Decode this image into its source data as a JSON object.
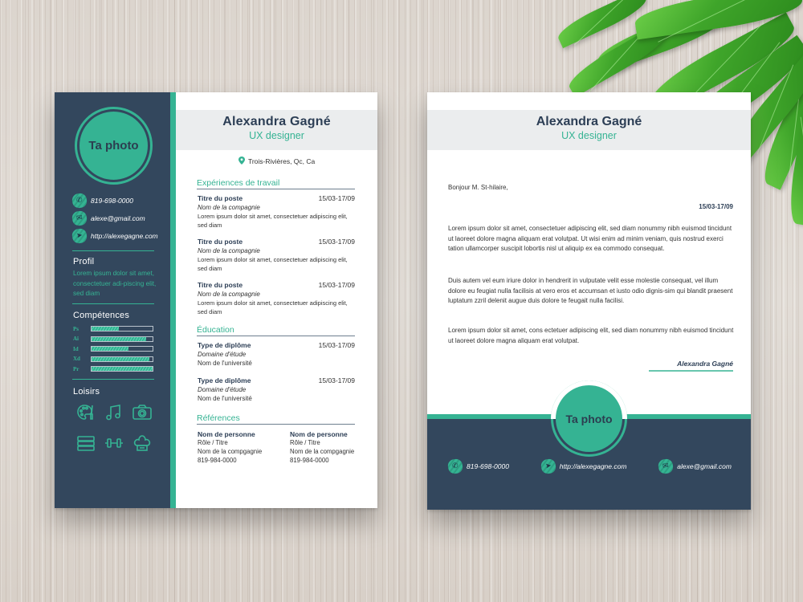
{
  "cv": {
    "photo_label": "Ta photo",
    "name": "Alexandra Gagné",
    "role": "UX designer",
    "location": "Trois-Rivières, Qc, Ca",
    "contacts": [
      {
        "icon": "phone-icon",
        "glyph": "✆",
        "text": "819-698-0000"
      },
      {
        "icon": "mail-icon",
        "glyph": "✉",
        "text": "alexe@gmail.com"
      },
      {
        "icon": "cursor-icon",
        "glyph": "➤",
        "text": "http://alexegagne.com"
      }
    ],
    "profile": {
      "title": "Profil",
      "text": "Lorem ipsum dolor sit amet, consectetuer adi-piscing elit, sed diam"
    },
    "skills": {
      "title": "Compétences",
      "items": [
        {
          "label": "Ps",
          "level": 0.45
        },
        {
          "label": "Ai",
          "level": 0.9
        },
        {
          "label": "Id",
          "level": 0.6
        },
        {
          "label": "Xd",
          "level": 0.95
        },
        {
          "label": "Pr",
          "level": 1.0
        }
      ]
    },
    "hobbies": {
      "title": "Loisirs",
      "icons": [
        "palette-icon",
        "music-note-icon",
        "camera-icon",
        "books-icon",
        "dumbbell-icon",
        "chef-hat-icon"
      ]
    },
    "experience": {
      "title": "Expériences de travail",
      "items": [
        {
          "title": "Titre du poste",
          "date": "15/03-17/09",
          "company": "Nom de la compagnie",
          "desc": "Lorem ipsum dolor sit amet, consectetuer adipiscing elit, sed diam"
        },
        {
          "title": "Titre du poste",
          "date": "15/03-17/09",
          "company": "Nom de la compagnie",
          "desc": "Lorem ipsum dolor sit amet, consectetuer adipiscing elit, sed diam"
        },
        {
          "title": "Titre du poste",
          "date": "15/03-17/09",
          "company": "Nom de la compagnie",
          "desc": "Lorem ipsum dolor sit amet, consectetuer adipiscing elit, sed diam"
        }
      ]
    },
    "education": {
      "title": "Éducation",
      "items": [
        {
          "title": "Type de diplôme",
          "date": "15/03-17/09",
          "field": "Domaine d'étude",
          "school": "Nom de l'université"
        },
        {
          "title": "Type de diplôme",
          "date": "15/03-17/09",
          "field": "Domaine d'étude",
          "school": "Nom de l'université"
        }
      ]
    },
    "references": {
      "title": "Références",
      "items": [
        {
          "name": "Nom de personne",
          "role": "Rôle / Titre",
          "company": "Nom de la compgagnie",
          "phone": "819-984-0000"
        },
        {
          "name": "Nom de personne",
          "role": "Rôle / Titre",
          "company": "Nom de la compgagnie",
          "phone": "819-984-0000"
        }
      ]
    }
  },
  "letter": {
    "name": "Alexandra Gagné",
    "role": "UX designer",
    "greeting": "Bonjour M. St-hilaire,",
    "date": "15/03-17/09",
    "paragraphs": [
      "Lorem ipsum dolor sit amet, consectetuer adipiscing elit, sed diam nonummy nibh euismod tincidunt ut laoreet dolore magna aliquam erat volutpat. Ut wisi enim ad minim veniam, quis nostrud exerci tation ullamcorper suscipit lobortis nisl ut aliquip ex ea commodo consequat.",
      "Duis autem vel eum iriure dolor in hendrerit in vulputate velit esse molestie consequat, vel illum dolore eu feugiat nulla facilisis at vero eros et accumsan et iusto odio dignis-sim qui blandit praesent luptatum zzril delenit augue duis dolore te feugait nulla facilisi.",
      "Lorem ipsum dolor sit amet, cons ectetuer adipiscing elit, sed diam nonummy nibh euismod tincidunt ut laoreet dolore magna aliquam erat volutpat."
    ],
    "signature": "Alexandra Gagné",
    "photo_label": "Ta photo",
    "contacts": [
      {
        "icon": "phone-icon",
        "glyph": "✆",
        "text": "819-698-0000"
      },
      {
        "icon": "cursor-icon",
        "glyph": "➤",
        "text": "http://alexegagne.com"
      },
      {
        "icon": "mail-icon",
        "glyph": "✉",
        "text": "alexe@gmail.com"
      }
    ]
  },
  "colors": {
    "navy": "#33475d",
    "teal": "#35b393",
    "header_gray": "#ebedee"
  }
}
